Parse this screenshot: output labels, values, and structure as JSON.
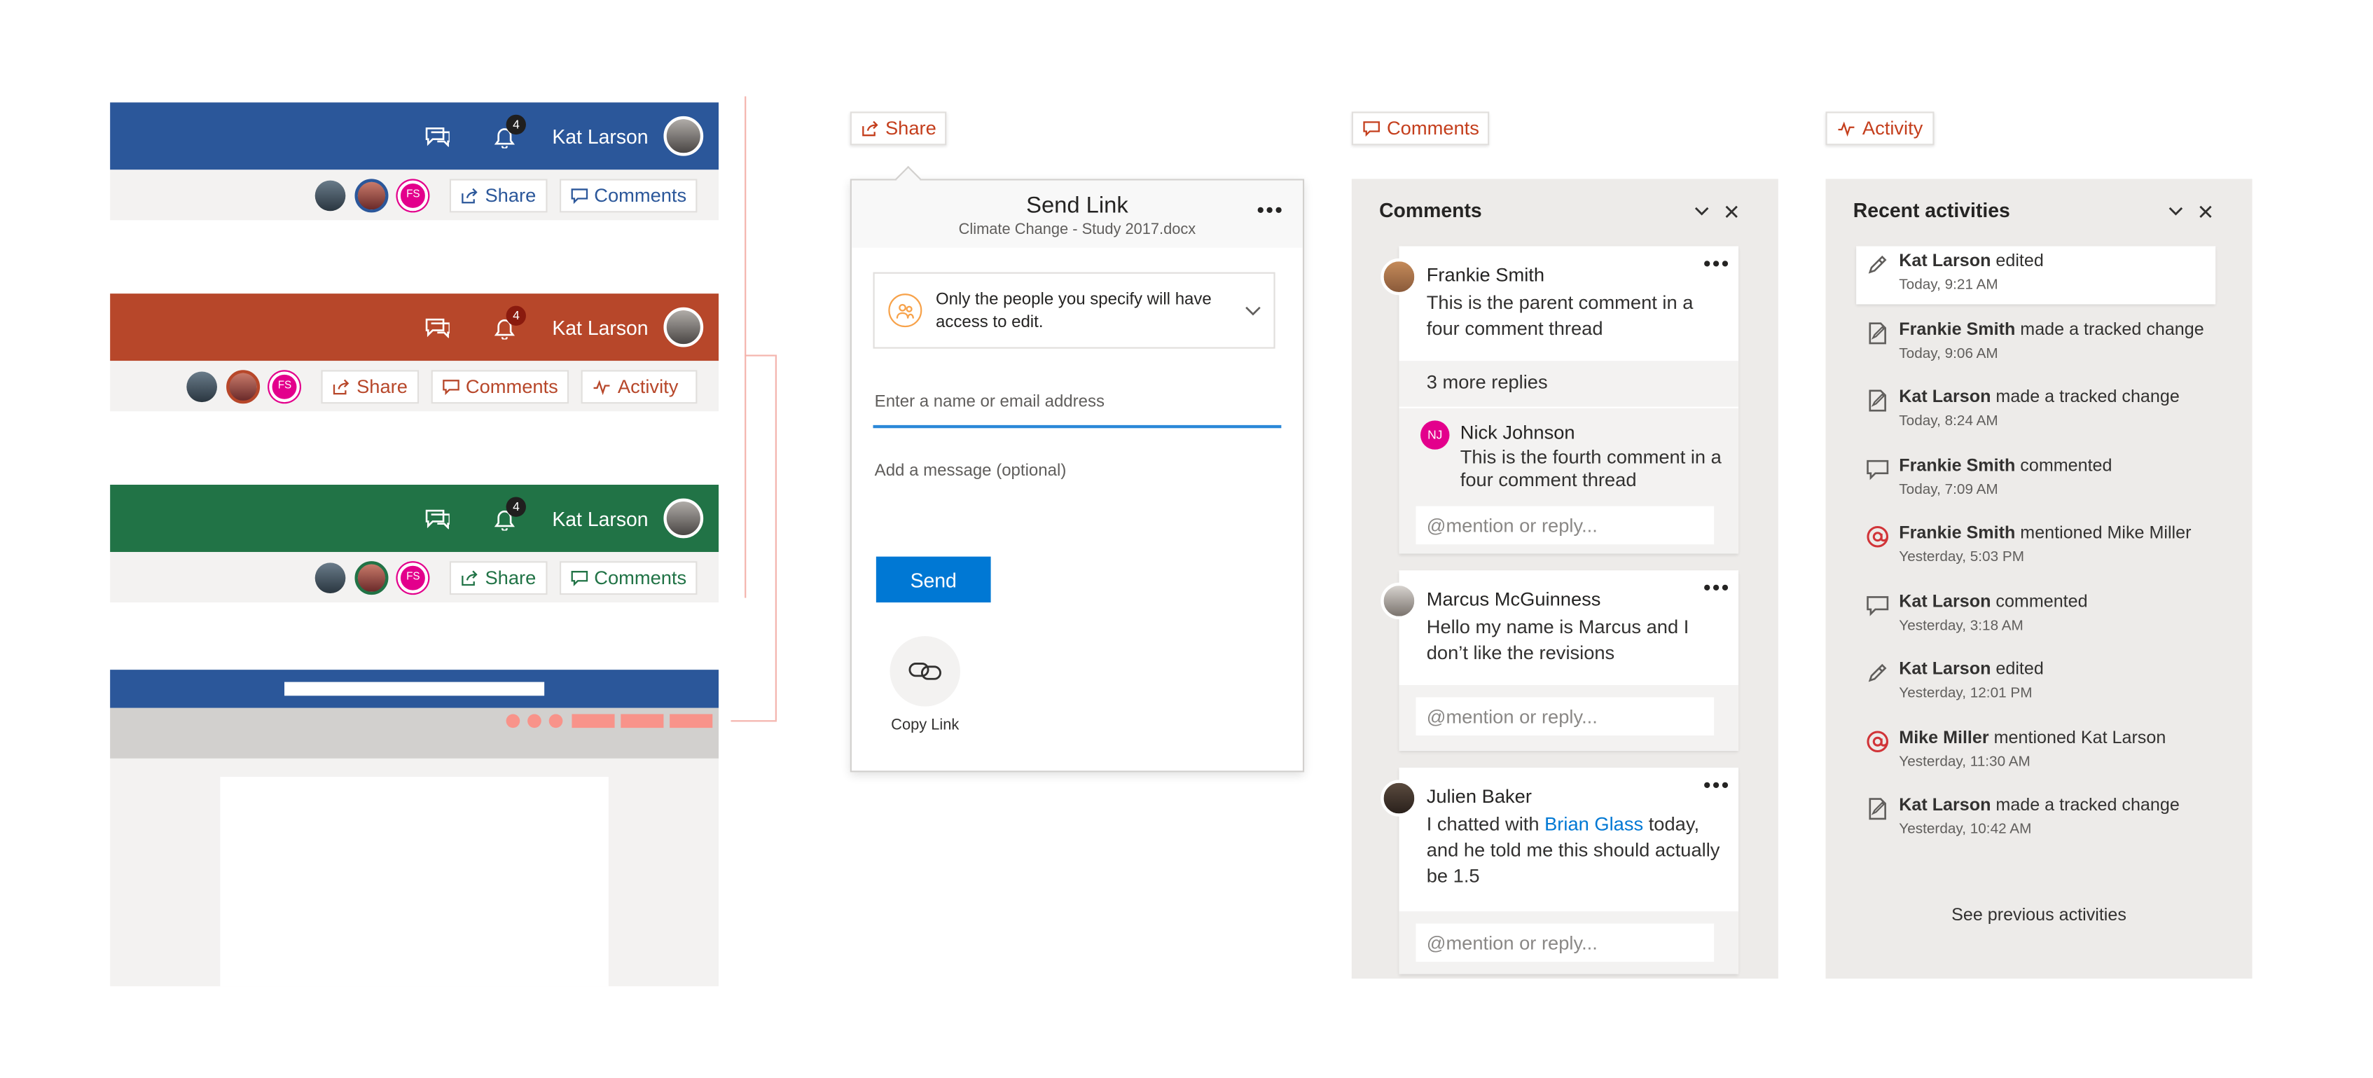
{
  "headers": [
    {
      "color": "#2b579a",
      "badge": "4",
      "user": "Kat Larson",
      "share": "Share",
      "comments": "Comments",
      "activity": "",
      "initials": "FS"
    },
    {
      "color": "#b7472a",
      "badge": "4",
      "user": "Kat Larson",
      "share": "Share",
      "comments": "Comments",
      "activity": "Activity",
      "initials": "FS"
    },
    {
      "color": "#217346",
      "badge": "4",
      "user": "Kat Larson",
      "share": "Share",
      "comments": "Comments",
      "activity": "",
      "initials": "FS"
    }
  ],
  "tags": {
    "share": "Share",
    "comments": "Comments",
    "activity": "Activity"
  },
  "share_dialog": {
    "title": "Send Link",
    "subtitle": "Climate Change - Study 2017.docx",
    "permission": "Only the people you specify will have access to edit.",
    "name_placeholder": "Enter a name or email address",
    "message_placeholder": "Add a message (optional)",
    "send": "Send",
    "copy_link": "Copy Link"
  },
  "comments_panel": {
    "title": "Comments",
    "threads": [
      {
        "author": "Frankie Smith",
        "text": "This is the parent comment in a four comment thread",
        "more": "3 more replies",
        "reply_author": "Nick Johnson",
        "reply_initials": "NJ",
        "reply_text": "This is the fourth comment in a four comment thread",
        "reply_placeholder": "@mention or reply..."
      },
      {
        "author": "Marcus McGuinness",
        "text": "Hello my name is Marcus and I don’t like the revisions",
        "reply_placeholder": "@mention or reply..."
      },
      {
        "author": "Julien Baker",
        "text_before": "I chatted with ",
        "mention": "Brian Glass",
        "text_after": " today, and he told me this should actually be 1.5",
        "reply_placeholder": "@mention or reply..."
      }
    ]
  },
  "activity_panel": {
    "title": "Recent activities",
    "items": [
      {
        "icon": "pencil-icon",
        "name": "Kat Larson",
        "action": " edited",
        "time": "Today, 9:21 AM"
      },
      {
        "icon": "tracked-change-icon",
        "name": "Frankie Smith",
        "action": " made a tracked change",
        "time": "Today, 9:06 AM"
      },
      {
        "icon": "tracked-change-icon",
        "name": "Kat Larson",
        "action": " made a tracked change",
        "time": "Today, 8:24 AM"
      },
      {
        "icon": "comment-icon",
        "name": "Frankie Smith",
        "action": " commented",
        "time": "Today, 7:09 AM"
      },
      {
        "icon": "mention-icon",
        "name": "Frankie Smith",
        "action": " mentioned Mike Miller",
        "time": "Yesterday, 5:03 PM"
      },
      {
        "icon": "comment-icon",
        "name": "Kat Larson",
        "action": " commented",
        "time": "Yesterday, 3:18 AM"
      },
      {
        "icon": "pencil-icon",
        "name": "Kat Larson",
        "action": " edited",
        "time": "Yesterday, 12:01 PM"
      },
      {
        "icon": "mention-icon",
        "name": "Mike Miller",
        "action": " mentioned Kat Larson",
        "time": "Yesterday, 11:30 AM"
      },
      {
        "icon": "tracked-change-icon",
        "name": "Kat Larson",
        "action": " made a tracked change",
        "time": "Yesterday, 10:42 AM"
      }
    ],
    "see_previous": "See previous activities"
  }
}
